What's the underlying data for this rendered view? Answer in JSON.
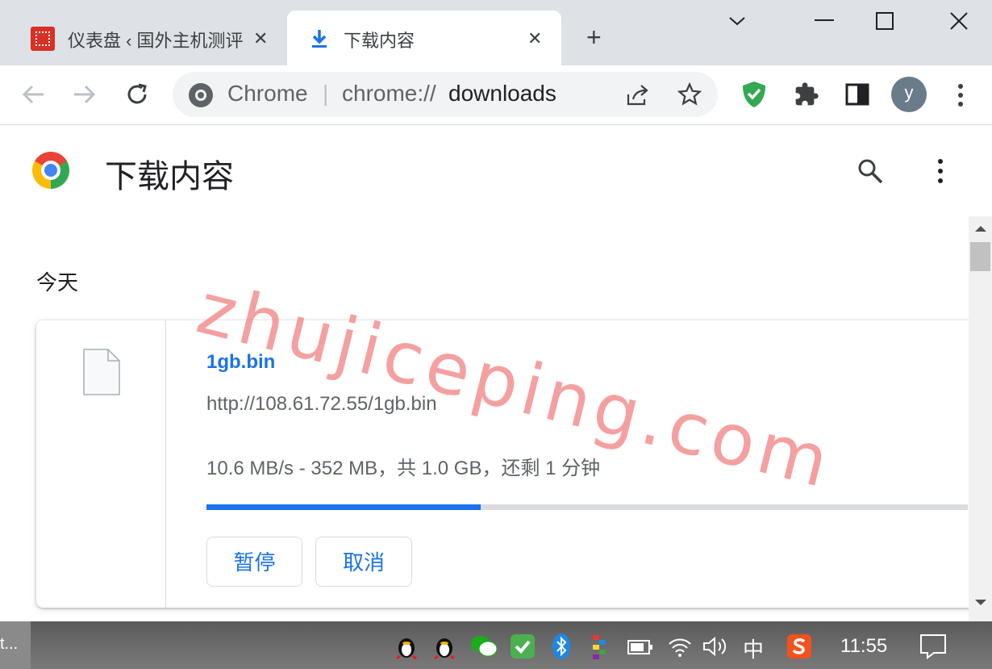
{
  "tabs": [
    {
      "title": "仪表盘 ‹ 国外主机测评",
      "close": "✕",
      "favicon": "site-favicon"
    },
    {
      "title": "下载内容",
      "close": "✕",
      "favicon": "download-icon"
    }
  ],
  "toolbar": {
    "omnibox_prefix": "Chrome",
    "omnibox_separator": "|",
    "omnibox_url_scheme": "chrome://",
    "omnibox_url_path": "downloads",
    "avatar_letter": "y"
  },
  "page": {
    "title": "下载内容",
    "date_group": "今天"
  },
  "download": {
    "file_name": "1gb.bin",
    "url": "http://108.61.72.55/1gb.bin",
    "status": "10.6 MB/s - 352 MB，共 1.0 GB，还剩 1 分钟",
    "progress_fraction": 0.36,
    "pause_label": "暂停",
    "cancel_label": "取消"
  },
  "watermark": "zhujiceping.com",
  "taskbar": {
    "left_label": "t...",
    "ime_label": "中",
    "clock": "11:55"
  },
  "colors": {
    "accent": "#1a73e8",
    "shield": "#34a853",
    "titlebar": "#dee1e6"
  }
}
